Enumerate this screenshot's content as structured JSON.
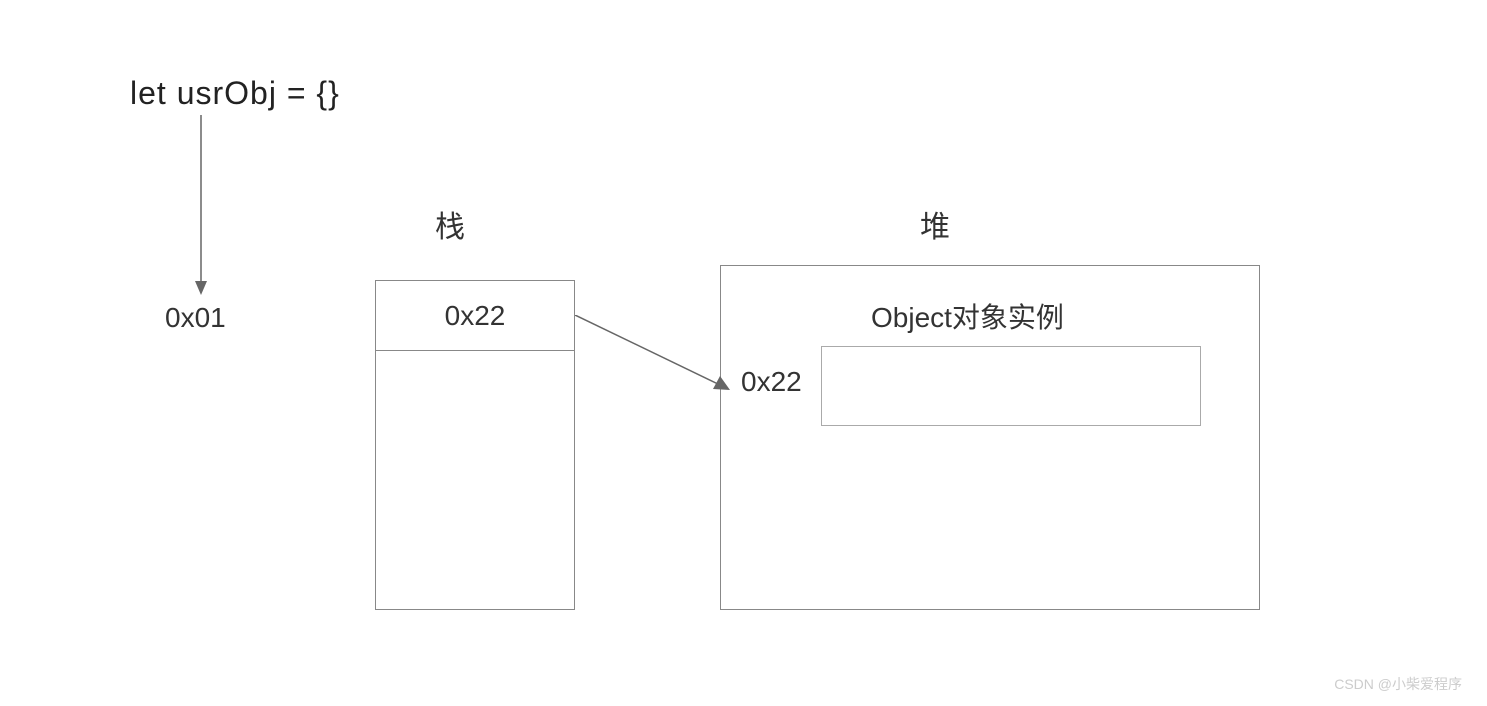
{
  "code": "let  usrObj =  {}",
  "variableAddress": "0x01",
  "stack": {
    "title": "栈",
    "cellValue": "0x22"
  },
  "heap": {
    "title": "堆",
    "instanceLabel": "Object对象实例",
    "instanceAddress": "0x22"
  },
  "watermark": "CSDN @小柴爱程序"
}
